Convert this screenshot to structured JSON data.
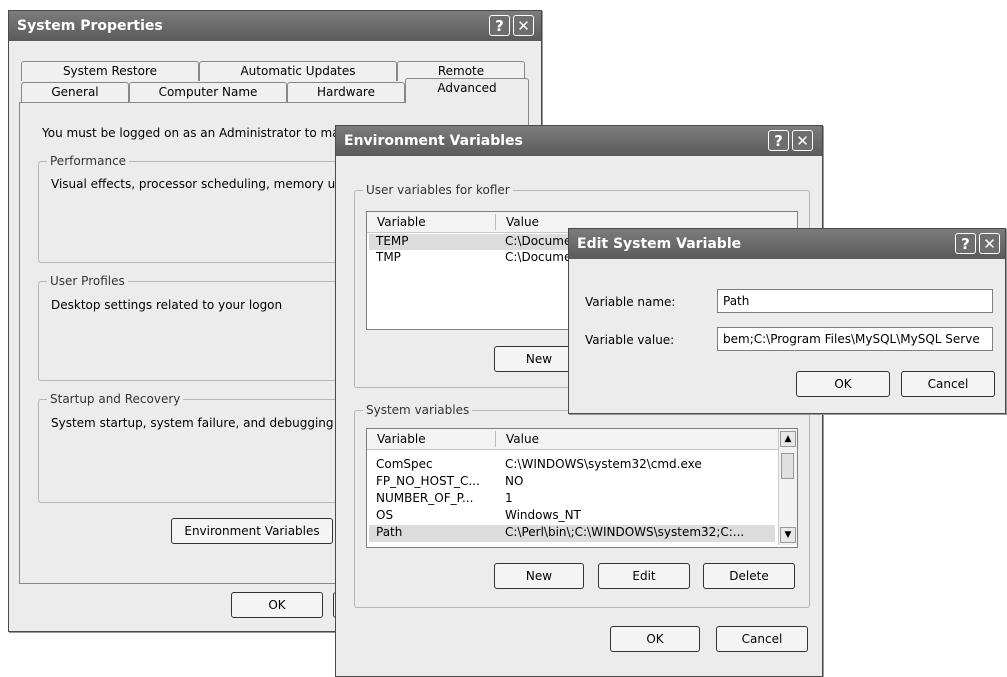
{
  "system_properties": {
    "title": "System Properties",
    "help_button": "?",
    "close_button": "✕",
    "tabs_back": [
      "System Restore",
      "Automatic Updates",
      "Remote"
    ],
    "tabs_front": [
      "General",
      "Computer Name",
      "Hardware",
      "Advanced"
    ],
    "admin_notice": "You must be logged on as an Administrator to ma",
    "performance_label": "Performance",
    "performance_text": "Visual effects, processor scheduling, memory us",
    "user_profiles_label": "User Profiles",
    "user_profiles_text": "Desktop settings related to your logon",
    "startup_label": "Startup and Recovery",
    "startup_text": "System startup, system failure, and debugging in",
    "env_vars_button": "Environment Variables",
    "ok_button": "OK"
  },
  "env_vars": {
    "title": "Environment Variables",
    "help_button": "?",
    "close_button": "✕",
    "user_group_label": "User variables for kofler",
    "user_columns": [
      "Variable",
      "Value"
    ],
    "user_rows": [
      {
        "variable": "TEMP",
        "value": "C:\\Docume"
      },
      {
        "variable": "TMP",
        "value": "C:\\Docume"
      }
    ],
    "user_new_button": "New",
    "system_group_label": "System variables",
    "system_columns": [
      "Variable",
      "Value"
    ],
    "system_rows": [
      {
        "variable": "ComSpec",
        "value": "C:\\WINDOWS\\system32\\cmd.exe"
      },
      {
        "variable": "FP_NO_HOST_C...",
        "value": "NO"
      },
      {
        "variable": "NUMBER_OF_P...",
        "value": "1"
      },
      {
        "variable": "OS",
        "value": "Windows_NT"
      },
      {
        "variable": "Path",
        "value": "C:\\Perl\\bin\\;C:\\WINDOWS\\system32;C:..."
      }
    ],
    "system_new_button": "New",
    "system_edit_button": "Edit",
    "system_delete_button": "Delete",
    "ok_button": "OK",
    "cancel_button": "Cancel"
  },
  "edit_system_variable": {
    "title": "Edit System Variable",
    "help_button": "?",
    "close_button": "✕",
    "name_label": "Variable name:",
    "name_value": "Path",
    "value_label": "Variable value:",
    "value_value": "bem;C:\\Program Files\\MySQL\\MySQL Serve",
    "ok_button": "OK",
    "cancel_button": "Cancel"
  }
}
